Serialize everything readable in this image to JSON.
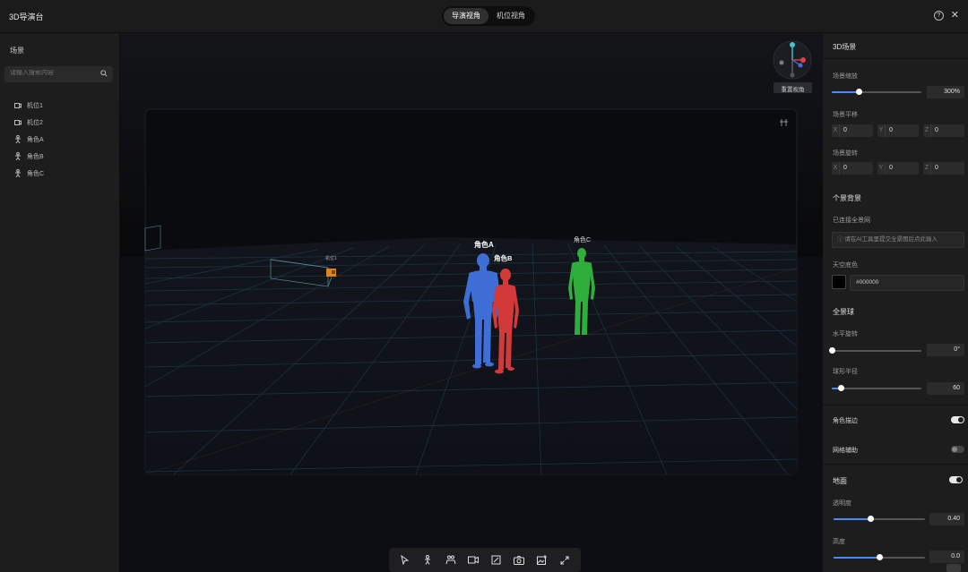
{
  "app": {
    "title": "3D导演台"
  },
  "view_toggle": {
    "director_label": "导演视角",
    "camera_label": "机位视角"
  },
  "top_icons": {
    "help": "help-icon",
    "close": "close-icon"
  },
  "left_panel": {
    "title": "场景",
    "search_placeholder": "请输入搜索内容",
    "items": [
      {
        "label": "机位1",
        "icon": "camera-icon"
      },
      {
        "label": "机位2",
        "icon": "camera-icon"
      },
      {
        "label": "角色A",
        "icon": "figure-icon"
      },
      {
        "label": "角色B",
        "icon": "figure-icon"
      },
      {
        "label": "角色C",
        "icon": "figure-icon"
      }
    ]
  },
  "viewport": {
    "reset_view_label": "重置视角",
    "camera_label": "机位1",
    "characters": [
      {
        "label": "角色A",
        "color": "#3f6fd6"
      },
      {
        "label": "角色B",
        "color": "#d23a3a"
      },
      {
        "label": "角色C",
        "color": "#2fae3c"
      }
    ]
  },
  "toolbar": {
    "tools": [
      "select-icon",
      "figure-icon",
      "people-icon",
      "camera-icon",
      "crop-icon",
      "screenshot-icon",
      "image-add-icon",
      "fullscreen-icon"
    ]
  },
  "right_panel": {
    "title": "3D场景",
    "scene_scale": {
      "label": "场景缩放",
      "value": "300%",
      "level": 0.3
    },
    "scene_translate": {
      "label": "场景平移",
      "x": "0",
      "y": "0",
      "z": "0"
    },
    "scene_rotate": {
      "label": "场景旋转",
      "x": "0",
      "y": "0",
      "z": "0"
    },
    "background_section": "个景背景",
    "upload_label": "已连接全景网",
    "upload_placeholder": "请在AI工具里提交全景图后点此输入",
    "bg_color": {
      "label": "天空底色",
      "value": "#000000"
    },
    "panorama_section": "全景球",
    "h_rotate": {
      "label": "水平旋转",
      "value": "0°",
      "level": 0.0
    },
    "sphere_radius": {
      "label": "球形半径",
      "value": "60",
      "level": 0.1
    },
    "show_characters": {
      "label": "角色描边",
      "on": true
    },
    "grid_display": {
      "label": "网格辅助",
      "on": false
    },
    "ground_section": "地面",
    "ground_on": true,
    "opacity": {
      "label": "透明度",
      "value": "0.40",
      "level": 0.4
    },
    "height": {
      "label": "高度",
      "value": "0.0",
      "level": 0.5
    }
  },
  "colors": {
    "accent": "#4a8cff",
    "grid": "#1d3a4a"
  }
}
